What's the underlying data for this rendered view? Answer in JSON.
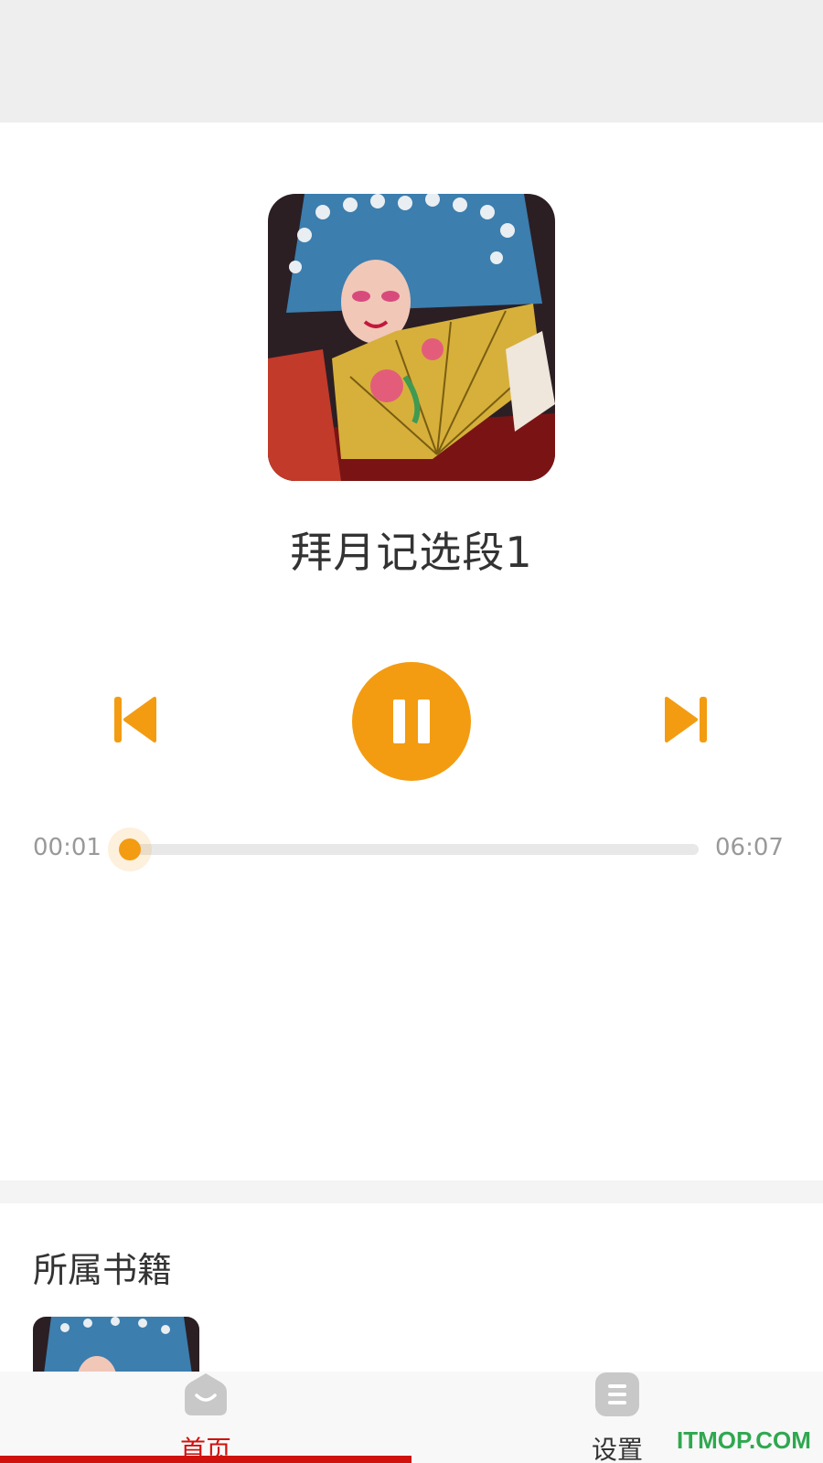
{
  "player": {
    "track_title": "拜月记选段1",
    "current_time": "00:01",
    "total_time": "06:07",
    "progress_fraction": 0.003,
    "state": "playing",
    "controls": {
      "prev_icon": "skip-previous-icon",
      "play_pause_icon": "pause-icon",
      "next_icon": "skip-next-icon"
    }
  },
  "book_section": {
    "title": "所属书籍"
  },
  "tabbar": {
    "tabs": [
      {
        "label": "首页",
        "icon": "home-icon",
        "active": true
      },
      {
        "label": "设置",
        "icon": "settings-icon",
        "active": false
      }
    ]
  },
  "watermark": "ITMOP.COM",
  "colors": {
    "accent": "#f39c12",
    "active_tab": "#d0120e",
    "inactive_tab": "#333333",
    "tab_icon": "#c8c8c8",
    "progress_track": "#e8e8e8",
    "watermark": "#2fa84f"
  }
}
